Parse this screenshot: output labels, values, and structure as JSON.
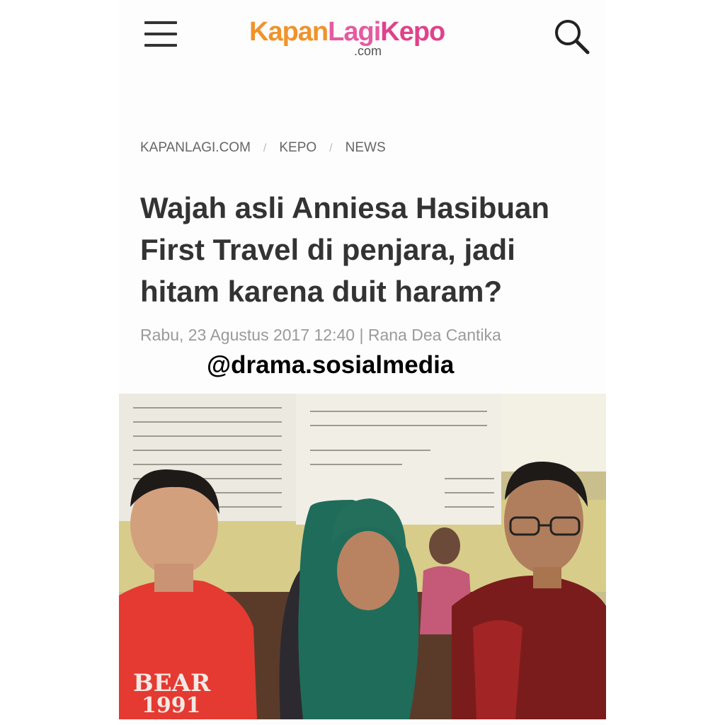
{
  "header": {
    "logo": {
      "part1": "Kapan",
      "part2": "Lagi",
      "part3": "Kepo",
      "suffix": ".com"
    }
  },
  "breadcrumb": {
    "items": [
      "KAPANLAGI.COM",
      "KEPO",
      "NEWS"
    ],
    "separator": "/"
  },
  "article": {
    "title": "Wajah asli Anniesa Hasibuan First Travel di penjara, jadi hitam karena duit haram?",
    "meta": "Rabu, 23 Agustus 2017 12:40 | Rana Dea Cantika",
    "watermark": "@drama.sosialmedia",
    "photo": {
      "shirt_text_top": "BEAR",
      "shirt_text_bottom": "1991"
    }
  },
  "icons": {
    "menu": "hamburger-menu-icon",
    "search": "search-icon"
  },
  "colors": {
    "logo_orange": "#f0932b",
    "logo_pink": "#e65aa0",
    "title": "#333333",
    "meta": "#9a9a9a"
  }
}
